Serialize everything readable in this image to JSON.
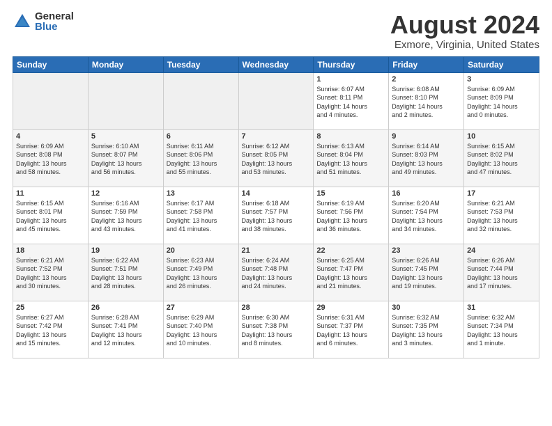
{
  "header": {
    "logo_general": "General",
    "logo_blue": "Blue",
    "main_title": "August 2024",
    "subtitle": "Exmore, Virginia, United States"
  },
  "calendar": {
    "weekdays": [
      "Sunday",
      "Monday",
      "Tuesday",
      "Wednesday",
      "Thursday",
      "Friday",
      "Saturday"
    ],
    "rows": [
      [
        {
          "day": "",
          "info": ""
        },
        {
          "day": "",
          "info": ""
        },
        {
          "day": "",
          "info": ""
        },
        {
          "day": "",
          "info": ""
        },
        {
          "day": "1",
          "info": "Sunrise: 6:07 AM\nSunset: 8:11 PM\nDaylight: 14 hours\nand 4 minutes."
        },
        {
          "day": "2",
          "info": "Sunrise: 6:08 AM\nSunset: 8:10 PM\nDaylight: 14 hours\nand 2 minutes."
        },
        {
          "day": "3",
          "info": "Sunrise: 6:09 AM\nSunset: 8:09 PM\nDaylight: 14 hours\nand 0 minutes."
        }
      ],
      [
        {
          "day": "4",
          "info": "Sunrise: 6:09 AM\nSunset: 8:08 PM\nDaylight: 13 hours\nand 58 minutes."
        },
        {
          "day": "5",
          "info": "Sunrise: 6:10 AM\nSunset: 8:07 PM\nDaylight: 13 hours\nand 56 minutes."
        },
        {
          "day": "6",
          "info": "Sunrise: 6:11 AM\nSunset: 8:06 PM\nDaylight: 13 hours\nand 55 minutes."
        },
        {
          "day": "7",
          "info": "Sunrise: 6:12 AM\nSunset: 8:05 PM\nDaylight: 13 hours\nand 53 minutes."
        },
        {
          "day": "8",
          "info": "Sunrise: 6:13 AM\nSunset: 8:04 PM\nDaylight: 13 hours\nand 51 minutes."
        },
        {
          "day": "9",
          "info": "Sunrise: 6:14 AM\nSunset: 8:03 PM\nDaylight: 13 hours\nand 49 minutes."
        },
        {
          "day": "10",
          "info": "Sunrise: 6:15 AM\nSunset: 8:02 PM\nDaylight: 13 hours\nand 47 minutes."
        }
      ],
      [
        {
          "day": "11",
          "info": "Sunrise: 6:15 AM\nSunset: 8:01 PM\nDaylight: 13 hours\nand 45 minutes."
        },
        {
          "day": "12",
          "info": "Sunrise: 6:16 AM\nSunset: 7:59 PM\nDaylight: 13 hours\nand 43 minutes."
        },
        {
          "day": "13",
          "info": "Sunrise: 6:17 AM\nSunset: 7:58 PM\nDaylight: 13 hours\nand 41 minutes."
        },
        {
          "day": "14",
          "info": "Sunrise: 6:18 AM\nSunset: 7:57 PM\nDaylight: 13 hours\nand 38 minutes."
        },
        {
          "day": "15",
          "info": "Sunrise: 6:19 AM\nSunset: 7:56 PM\nDaylight: 13 hours\nand 36 minutes."
        },
        {
          "day": "16",
          "info": "Sunrise: 6:20 AM\nSunset: 7:54 PM\nDaylight: 13 hours\nand 34 minutes."
        },
        {
          "day": "17",
          "info": "Sunrise: 6:21 AM\nSunset: 7:53 PM\nDaylight: 13 hours\nand 32 minutes."
        }
      ],
      [
        {
          "day": "18",
          "info": "Sunrise: 6:21 AM\nSunset: 7:52 PM\nDaylight: 13 hours\nand 30 minutes."
        },
        {
          "day": "19",
          "info": "Sunrise: 6:22 AM\nSunset: 7:51 PM\nDaylight: 13 hours\nand 28 minutes."
        },
        {
          "day": "20",
          "info": "Sunrise: 6:23 AM\nSunset: 7:49 PM\nDaylight: 13 hours\nand 26 minutes."
        },
        {
          "day": "21",
          "info": "Sunrise: 6:24 AM\nSunset: 7:48 PM\nDaylight: 13 hours\nand 24 minutes."
        },
        {
          "day": "22",
          "info": "Sunrise: 6:25 AM\nSunset: 7:47 PM\nDaylight: 13 hours\nand 21 minutes."
        },
        {
          "day": "23",
          "info": "Sunrise: 6:26 AM\nSunset: 7:45 PM\nDaylight: 13 hours\nand 19 minutes."
        },
        {
          "day": "24",
          "info": "Sunrise: 6:26 AM\nSunset: 7:44 PM\nDaylight: 13 hours\nand 17 minutes."
        }
      ],
      [
        {
          "day": "25",
          "info": "Sunrise: 6:27 AM\nSunset: 7:42 PM\nDaylight: 13 hours\nand 15 minutes."
        },
        {
          "day": "26",
          "info": "Sunrise: 6:28 AM\nSunset: 7:41 PM\nDaylight: 13 hours\nand 12 minutes."
        },
        {
          "day": "27",
          "info": "Sunrise: 6:29 AM\nSunset: 7:40 PM\nDaylight: 13 hours\nand 10 minutes."
        },
        {
          "day": "28",
          "info": "Sunrise: 6:30 AM\nSunset: 7:38 PM\nDaylight: 13 hours\nand 8 minutes."
        },
        {
          "day": "29",
          "info": "Sunrise: 6:31 AM\nSunset: 7:37 PM\nDaylight: 13 hours\nand 6 minutes."
        },
        {
          "day": "30",
          "info": "Sunrise: 6:32 AM\nSunset: 7:35 PM\nDaylight: 13 hours\nand 3 minutes."
        },
        {
          "day": "31",
          "info": "Sunrise: 6:32 AM\nSunset: 7:34 PM\nDaylight: 13 hours\nand 1 minute."
        }
      ]
    ]
  }
}
